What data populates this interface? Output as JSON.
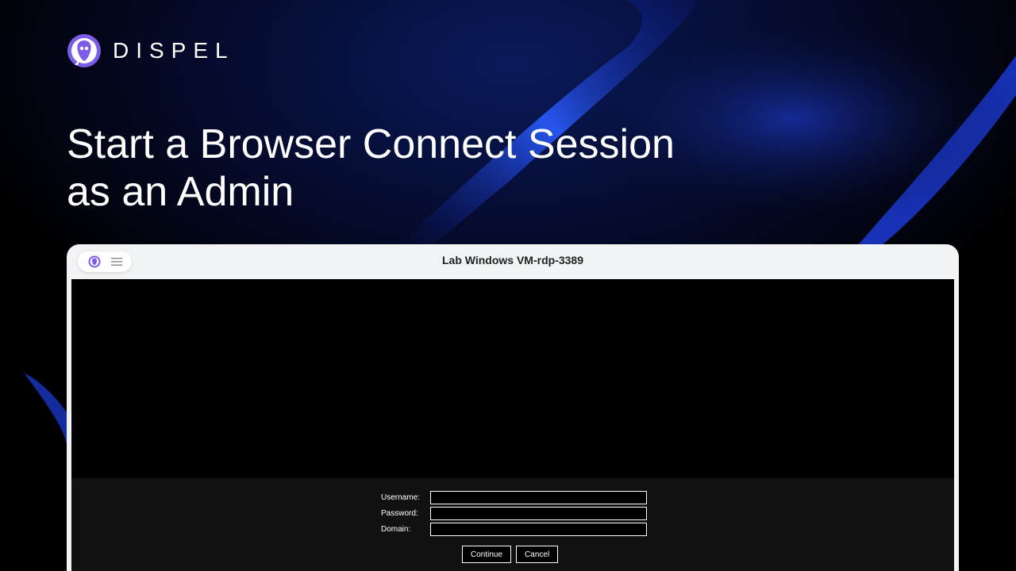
{
  "brand": {
    "name": "DISPEL",
    "logo_icon": "owl-logo-icon",
    "accent_color": "#8b5cf6"
  },
  "hero": {
    "title_line1": "Start a Browser Connect Session",
    "title_line2": "as an Admin"
  },
  "window": {
    "title": "Lab Windows VM-rdp-3389",
    "toolbar_icons": [
      "owl-logo-icon",
      "hamburger-menu-icon"
    ]
  },
  "login": {
    "username_label": "Username:",
    "password_label": "Password:",
    "domain_label": "Domain:",
    "username_value": "",
    "password_value": "",
    "domain_value": "",
    "continue_label": "Continue",
    "cancel_label": "Cancel"
  }
}
